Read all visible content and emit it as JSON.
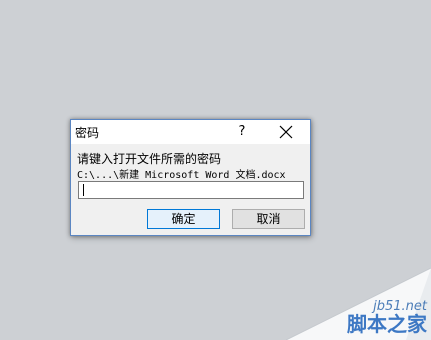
{
  "dialog": {
    "title": "密码",
    "help": "?",
    "prompt": "请键入打开文件所需的密码",
    "file_path": "C:\\...\\新建 Microsoft Word 文档.docx",
    "password_value": "",
    "ok_label": "确定",
    "cancel_label": "取消",
    "close_icon": "close-icon"
  },
  "watermark": {
    "site": "jb51.net",
    "name": "脚本之家"
  },
  "colors": {
    "desktop": "#cdd0d4",
    "dialog_border": "#5b86c2",
    "default_button_border": "#0078d7",
    "watermark_text": "#3d78c4"
  }
}
